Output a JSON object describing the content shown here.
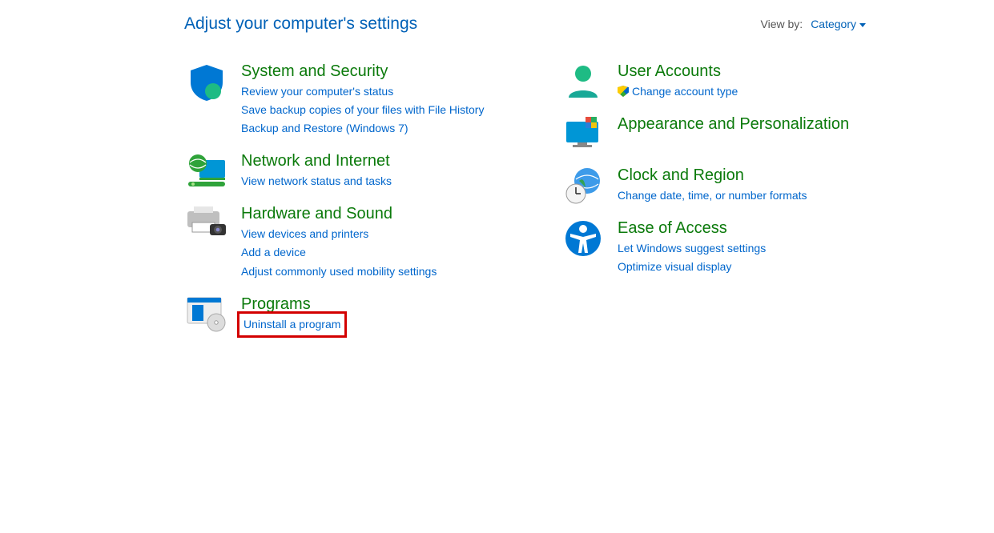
{
  "page_title": "Adjust your computer's settings",
  "viewby_label": "View by:",
  "viewby_value": "Category",
  "left": [
    {
      "id": "system-security",
      "title": "System and Security",
      "icon": "shield-icon",
      "links": [
        {
          "id": "review-status",
          "text": "Review your computer's status"
        },
        {
          "id": "file-history",
          "text": "Save backup copies of your files with File History"
        },
        {
          "id": "backup-win7",
          "text": "Backup and Restore (Windows 7)"
        }
      ]
    },
    {
      "id": "network-internet",
      "title": "Network and Internet",
      "icon": "globe-monitor-icon",
      "links": [
        {
          "id": "network-status",
          "text": "View network status and tasks"
        }
      ]
    },
    {
      "id": "hardware-sound",
      "title": "Hardware and Sound",
      "icon": "printer-camera-icon",
      "links": [
        {
          "id": "devices-printers",
          "text": "View devices and printers"
        },
        {
          "id": "add-device",
          "text": "Add a device"
        },
        {
          "id": "mobility",
          "text": "Adjust commonly used mobility settings"
        }
      ]
    },
    {
      "id": "programs",
      "title": "Programs",
      "icon": "disc-window-icon",
      "links": [
        {
          "id": "uninstall-program",
          "text": "Uninstall a program",
          "highlighted": true
        }
      ]
    }
  ],
  "right": [
    {
      "id": "user-accounts",
      "title": "User Accounts",
      "icon": "user-icon",
      "links": [
        {
          "id": "change-account-type",
          "text": "Change account type",
          "shielded": true
        }
      ]
    },
    {
      "id": "appearance",
      "title": "Appearance and Personalization",
      "icon": "monitor-colors-icon",
      "links": []
    },
    {
      "id": "clock-region",
      "title": "Clock and Region",
      "icon": "clock-globe-icon",
      "links": [
        {
          "id": "date-time-formats",
          "text": "Change date, time, or number formats"
        }
      ]
    },
    {
      "id": "ease-of-access",
      "title": "Ease of Access",
      "icon": "accessibility-icon",
      "links": [
        {
          "id": "suggest-settings",
          "text": "Let Windows suggest settings"
        },
        {
          "id": "optimize-display",
          "text": "Optimize visual display"
        }
      ]
    }
  ]
}
